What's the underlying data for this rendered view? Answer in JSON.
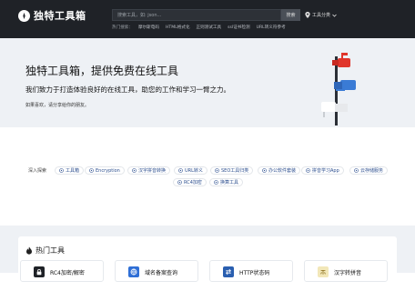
{
  "header": {
    "logo_text": "独特工具箱",
    "search_placeholder": "搜索工具，如: json...",
    "search_button": "搜索",
    "category_menu": "工具分类",
    "hot_search_label": "热门搜索：",
    "hot_search_items": [
      "摩尔斯电码",
      "HTML格式化",
      "正则测试工具",
      "ssl证书检测",
      "URL转义符参考"
    ]
  },
  "hero": {
    "title": "独特工具箱，提供免费在线工具",
    "subtitle": "我们致力于打造体验良好的在线工具，助您的工作和学习一臂之力。",
    "note": "如果喜欢，请分享给你的朋友。"
  },
  "tags": {
    "label": "深入探索",
    "items": [
      "工具箱",
      "Encryption",
      "汉字拼音转换",
      "URL转义",
      "SEO工具归类",
      "办公软件套装",
      "拼音学习App",
      "云存储服务",
      "RC4加密",
      "换算工具"
    ]
  },
  "hot_tools": {
    "title": "热门工具",
    "items": [
      {
        "name": "RC4加密/解密",
        "color": "#1f2227"
      },
      {
        "name": "域名备案查询",
        "color": "#2f6fd6"
      },
      {
        "name": "HTTP状态码",
        "color": "#2a5fb0"
      },
      {
        "name": "汉字转拼音",
        "color": "#f2e7b8"
      }
    ]
  },
  "colors": {
    "header_bg": "#1f2227",
    "hero_bg": "#eef1f5",
    "tag_text": "#2d4f8f",
    "mailbox_red": "#e0352b",
    "mailbox_blue": "#3a7bd5"
  }
}
